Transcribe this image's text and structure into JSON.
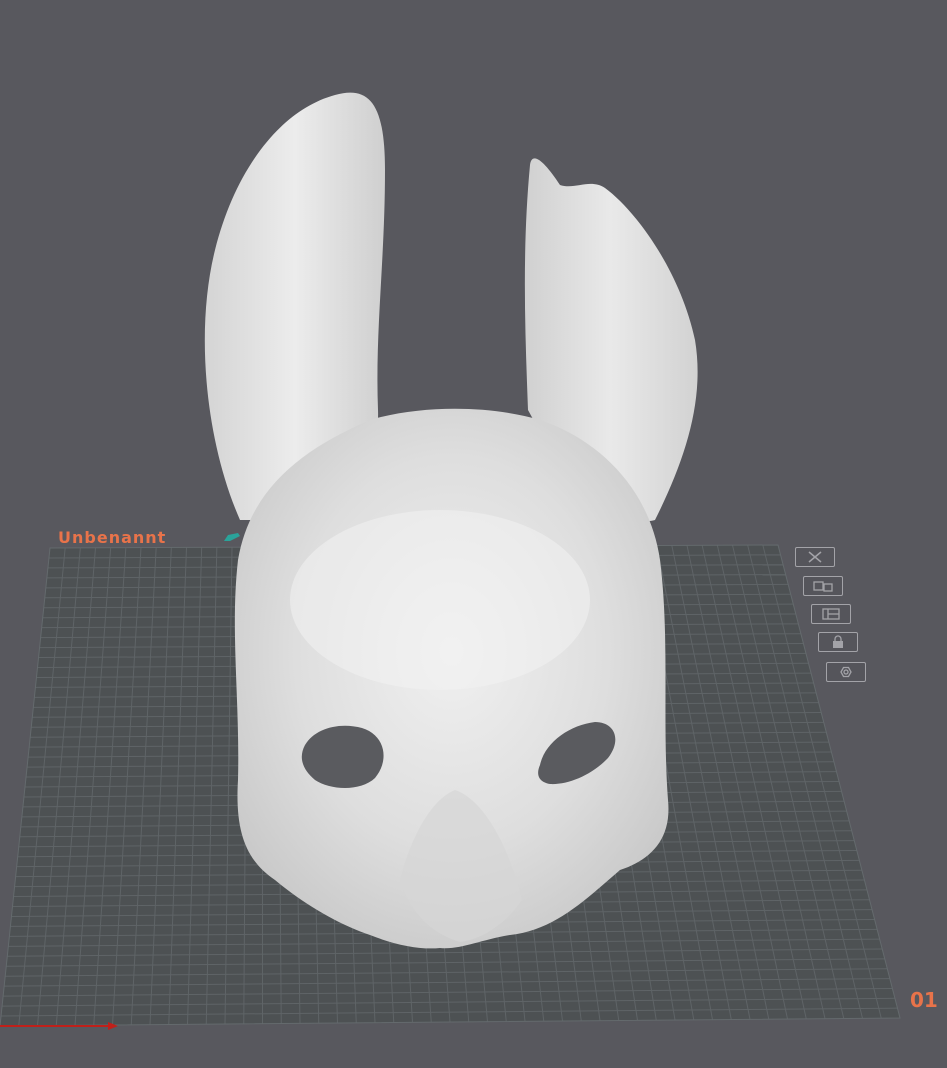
{
  "plate": {
    "name": "Unbenannt",
    "number": "01"
  },
  "toolbar": {
    "icons": [
      "close-icon",
      "auto-arrange-icon",
      "layout-icon",
      "lock-icon",
      "settings-icon"
    ]
  },
  "colors": {
    "background": "#58585e",
    "plate": "#4d5153",
    "grid": "#5e6366",
    "accent": "#e8734a",
    "model": "#e6e6e6",
    "axis_x": "#c0201a"
  }
}
